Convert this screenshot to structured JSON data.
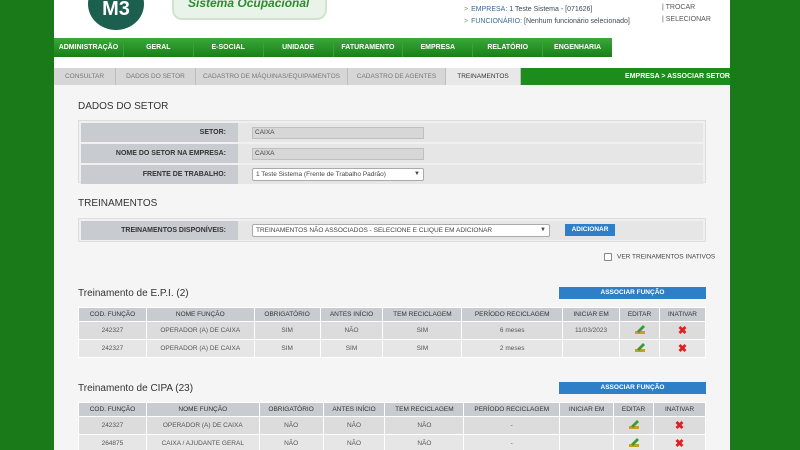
{
  "header": {
    "logo": "M3",
    "system_name": "Sistema Ocupacional",
    "empresa_label": "EMPRESA:",
    "empresa_value": "1 Teste Sistema - [071626]",
    "funcionario_label": "FUNCIONÁRIO:",
    "funcionario_value": "[Nenhum funcionário selecionado]",
    "trocar": "| TROCAR",
    "selecionar": "| SELECIONAR"
  },
  "mainnav": [
    "ADMINISTRAÇÃO",
    "GERAL",
    "E-SOCIAL",
    "UNIDADE",
    "FATURAMENTO",
    "EMPRESA",
    "RELATÓRIO",
    "ENGENHARIA"
  ],
  "subnav": {
    "tabs": [
      "CONSULTAR",
      "DADOS DO SETOR",
      "CADASTRO DE MÁQUINAS/EQUIPAMENTOS",
      "CADASTRO DE AGENTES",
      "TREINAMENTOS"
    ],
    "active": "TREINAMENTOS",
    "breadcrumb": "EMPRESA > ASSOCIAR SETOR"
  },
  "dados_setor": {
    "title": "DADOS DO SETOR",
    "setor_label": "SETOR:",
    "setor_value": "CAIXA",
    "nome_label": "NOME DO SETOR NA EMPRESA:",
    "nome_value": "CAIXA",
    "frente_label": "FRENTE DE TRABALHO:",
    "frente_value": "1 Teste Sistema (Frente de Trabalho Padrão)"
  },
  "treinamentos": {
    "title": "TREINAMENTOS",
    "disponiveis_label": "TREINAMENTOS DISPONÍVEIS:",
    "disponiveis_value": "TREINAMENTOS NÃO ASSOCIADOS - SELECIONE E CLIQUE EM ADICIONAR",
    "add_button": "ADICIONAR",
    "inativos_label": "VER TREINAMENTOS INATIVOS"
  },
  "columns": [
    "COD. FUNÇÃO",
    "NOME FUNÇÃO",
    "OBRIGATÓRIO",
    "ANTES INÍCIO",
    "TEM RECICLAGEM",
    "PERÍODO RECICLAGEM",
    "INICIAR EM",
    "EDITAR",
    "INATIVAR"
  ],
  "group_epi": {
    "title": "Treinamento de E.P.I. (2)",
    "assoc_button": "ASSOCIAR FUNÇÃO",
    "rows": [
      [
        "242327",
        "OPERADOR (A) DE CAIXA",
        "SIM",
        "NÃO",
        "SIM",
        "6 meses",
        "11/03/2023"
      ],
      [
        "242327",
        "OPERADOR (A) DE CAIXA",
        "SIM",
        "SIM",
        "SIM",
        "2 meses",
        ""
      ]
    ]
  },
  "group_cipa": {
    "title": "Treinamento de CIPA (23)",
    "assoc_button": "ASSOCIAR FUNÇÃO",
    "rows": [
      [
        "242327",
        "OPERADOR (A) DE CAIXA",
        "NÃO",
        "NÃO",
        "NÃO",
        "-",
        ""
      ],
      [
        "264875",
        "CAIXA / AJUDANTE GERAL",
        "NÃO",
        "NÃO",
        "NÃO",
        "-",
        ""
      ]
    ]
  },
  "colors": {
    "green": "#1c8c1c",
    "blue_button": "#2f7fc8",
    "delete_red": "#e02020"
  }
}
